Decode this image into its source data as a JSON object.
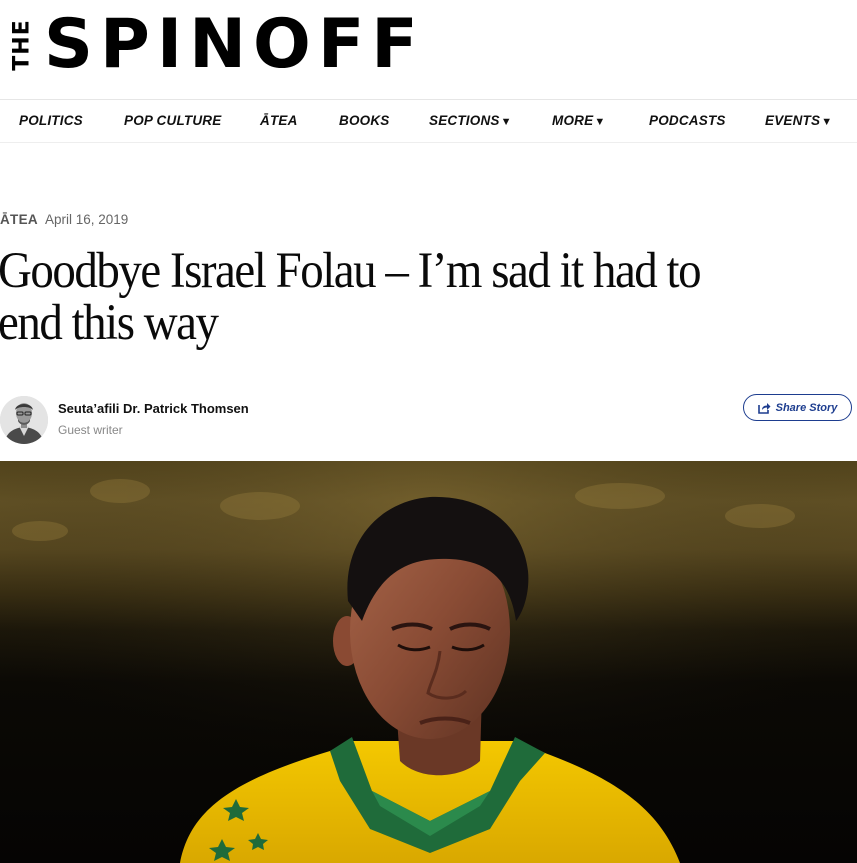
{
  "logo": {
    "the": "THE",
    "word": "SPINOFF"
  },
  "nav": {
    "items": [
      {
        "label": "POLITICS",
        "dropdown": false
      },
      {
        "label": "POP CULTURE",
        "dropdown": false
      },
      {
        "label": "ĀTEA",
        "dropdown": false
      },
      {
        "label": "BOOKS",
        "dropdown": false
      },
      {
        "label": "SECTIONS",
        "dropdown": true
      },
      {
        "label": "MORE",
        "dropdown": true
      },
      {
        "label": "PODCASTS",
        "dropdown": false
      },
      {
        "label": "EVENTS",
        "dropdown": true
      }
    ],
    "caret": "▼"
  },
  "article": {
    "category": "ĀTEA",
    "date": "April 16, 2019",
    "headline": "Goodbye Israel Folau – I’m sad it had to end this way",
    "author": {
      "name": "Seuta’afili Dr. Patrick Thomsen",
      "role": "Guest writer"
    },
    "share_label": "Share Story"
  },
  "colors": {
    "accent": "#1d3d8f",
    "jersey": "#f2c200",
    "collar": "#1f6b3a"
  }
}
